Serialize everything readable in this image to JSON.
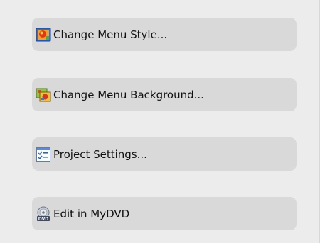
{
  "tasks": {
    "items": [
      {
        "label": "Change Menu Style...",
        "icon": "menu-style-icon"
      },
      {
        "label": "Change Menu Background...",
        "icon": "menu-background-icon"
      },
      {
        "label": "Project Settings...",
        "icon": "project-settings-icon"
      },
      {
        "label": "Edit in MyDVD",
        "icon": "dvd-icon"
      }
    ]
  },
  "colors": {
    "panel_bg": "#ececec",
    "button_bg": "#d9d9d9",
    "text": "#111111"
  }
}
